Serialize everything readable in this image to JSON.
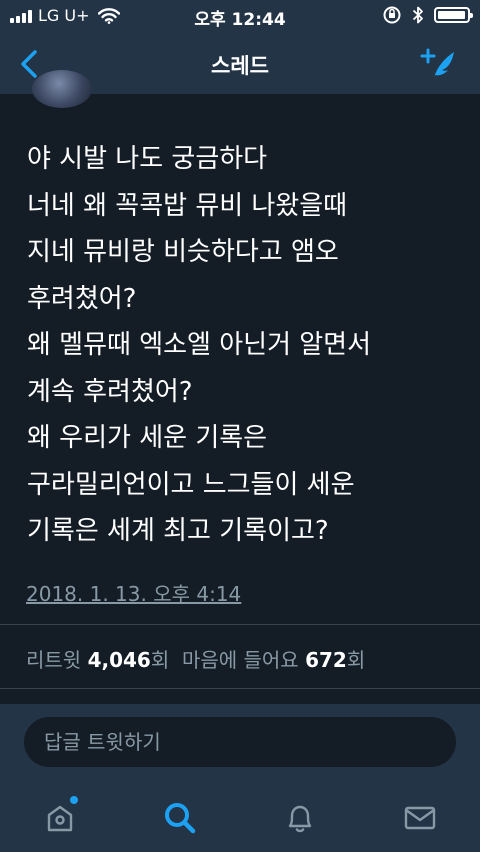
{
  "status_bar": {
    "carrier": "LG U+",
    "time": "오후 12:44"
  },
  "nav": {
    "title": "스레드",
    "back_icon": "chevron-left-icon",
    "compose_icon": "compose-tweet-icon"
  },
  "tweet": {
    "text": "야 시발 나도 궁금하다\n너네 왜 꼭콕밥 뮤비 나왔을때\n지네 뮤비랑 비슷하다고 앰오\n후려쳤어?\n왜 멜뮤때 엑소엘 아닌거 알면서\n계속 후려쳤어?\n왜 우리가 세운 기록은\n구라밀리언이고 느그들이 세운\n기록은 세계 최고 기록이고?",
    "timestamp": "2018. 1. 13. 오후 4:14",
    "retweet_label": "리트윗",
    "retweet_count": "4,046",
    "retweet_unit": "회",
    "like_label": "마음에 들어요",
    "like_count": "672",
    "like_unit": "회"
  },
  "reply": {
    "placeholder": "답글 트윗하기"
  },
  "tabs": [
    {
      "icon": "home-icon",
      "active": false,
      "has_notification_dot": true
    },
    {
      "icon": "search-icon",
      "active": true
    },
    {
      "icon": "bell-icon",
      "active": false
    },
    {
      "icon": "mail-icon",
      "active": false
    }
  ],
  "colors": {
    "background": "#141d26",
    "bar": "#243447",
    "accent": "#1da1f2",
    "secondary_text": "#8899a6"
  }
}
